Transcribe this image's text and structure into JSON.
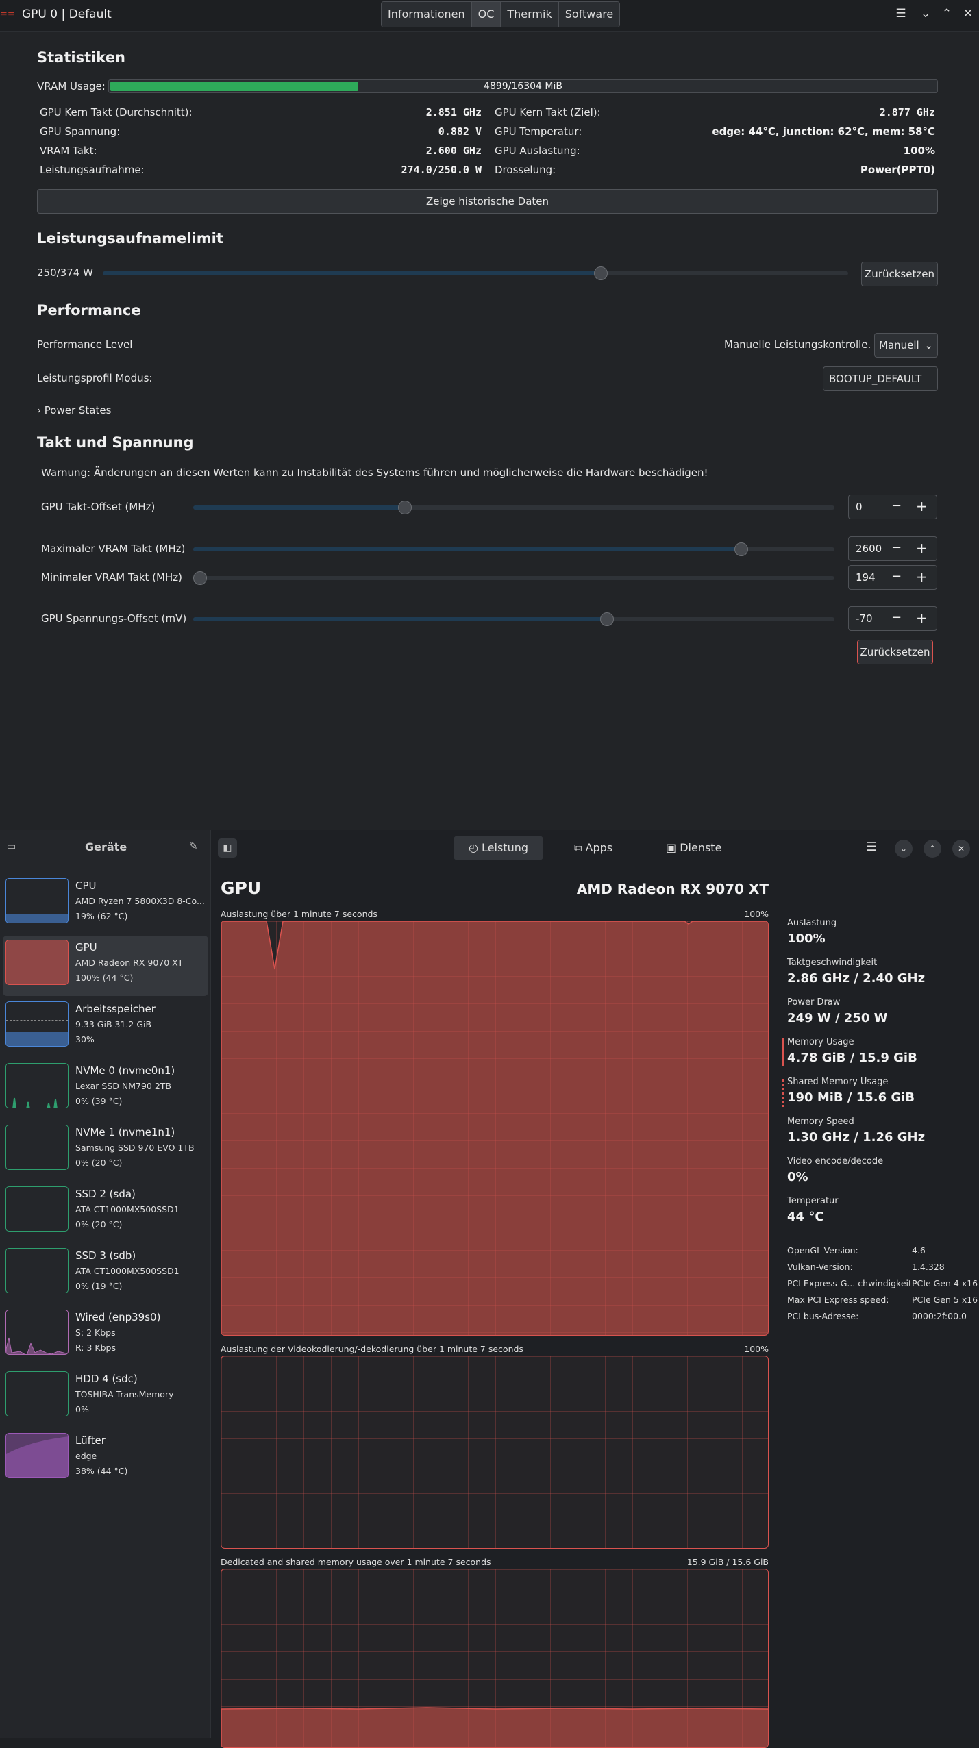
{
  "window": {
    "title": "GPU 0 | Default",
    "tabs": [
      "Informationen",
      "OC",
      "Thermik",
      "Software"
    ],
    "active_tab": "OC"
  },
  "stats": {
    "heading": "Statistiken",
    "vram_label": "VRAM Usage:",
    "vram_text": "4899/16304 MiB",
    "vram_used": 4899,
    "vram_total": 16304,
    "left": [
      {
        "label": "GPU Kern Takt (Durchschnitt):",
        "value": "2.851 GHz"
      },
      {
        "label": "GPU Spannung:",
        "value": "0.882 V"
      },
      {
        "label": "VRAM Takt:",
        "value": "2.600 GHz"
      },
      {
        "label": "Leistungsaufnahme:",
        "value": "274.0/250.0 W"
      }
    ],
    "right": [
      {
        "label": "GPU Kern Takt (Ziel):",
        "value": "2.877 GHz"
      },
      {
        "label": "GPU Temperatur:",
        "value": "edge: 44°C, junction: 62°C, mem: 58°C"
      },
      {
        "label": "GPU Auslastung:",
        "value": "100%"
      },
      {
        "label": "Drosselung:",
        "value": "Power(PPT0)"
      }
    ],
    "history_button": "Zeige historische Daten"
  },
  "power_limit": {
    "heading": "Leistungsaufnamelimit",
    "label": "250/374 W",
    "value": 250,
    "max": 374,
    "reset": "Zurücksetzen"
  },
  "performance": {
    "heading": "Performance",
    "level_label": "Performance Level",
    "level_hint": "Manuelle Leistungskontrolle.",
    "level_value": "Manuell",
    "profile_label": "Leistungsprofil Modus:",
    "profile_value": "BOOTUP_DEFAULT",
    "power_states": "Power States"
  },
  "clock": {
    "heading": "Takt und Spannung",
    "warning": "Warnung: Änderungen an diesen Werten kann zu Instabilität des Systems führen und möglicherweise die Hardware beschädigen!",
    "rows": [
      {
        "label": "GPU Takt-Offset (MHz)",
        "value": "0",
        "fraction": 0.33
      },
      {
        "label": "Maximaler VRAM Takt (MHz)",
        "value": "2600",
        "fraction": 0.855
      },
      {
        "label": "Minimaler VRAM Takt (MHz)",
        "value": "194",
        "fraction": 0.0
      },
      {
        "label": "GPU Spannungs-Offset (mV)",
        "value": "-70",
        "fraction": 0.645
      }
    ],
    "reset": "Zurücksetzen"
  },
  "monitor": {
    "sidebar_title": "Geräte",
    "devices": [
      {
        "name": "CPU",
        "line1": "AMD Ryzen 7 5800X3D 8-Co...",
        "line2": "19% (62 °C)",
        "color": "#4a86d8"
      },
      {
        "name": "GPU",
        "line1": "AMD Radeon RX 9070 XT",
        "line2": "100% (44 °C)",
        "color": "#d9534f"
      },
      {
        "name": "Arbeitsspeicher",
        "line1": "9.33 GiB 31.2 GiB",
        "line2": "30%",
        "color": "#4a86d8"
      },
      {
        "name": "NVMe 0 (nvme0n1)",
        "line1": "Lexar SSD NM790 2TB",
        "line2": "0% (39 °C)",
        "color": "#2e9e6e"
      },
      {
        "name": "NVMe 1 (nvme1n1)",
        "line1": "Samsung SSD 970 EVO 1TB",
        "line2": "0% (20 °C)",
        "color": "#2e9e6e"
      },
      {
        "name": "SSD 2 (sda)",
        "line1": "ATA CT1000MX500SSD1",
        "line2": "0% (20 °C)",
        "color": "#2e9e6e"
      },
      {
        "name": "SSD 3 (sdb)",
        "line1": "ATA CT1000MX500SSD1",
        "line2": "0% (19 °C)",
        "color": "#2e9e6e"
      },
      {
        "name": "Wired (enp39s0)",
        "line1": "S: 2 Kbps",
        "line2": "R: 3 Kbps",
        "color": "#b06ab3"
      },
      {
        "name": "HDD 4 (sdc)",
        "line1": "TOSHIBA TransMemory",
        "line2": "0%",
        "color": "#2e9e6e"
      },
      {
        "name": "Lüfter",
        "line1": "edge",
        "line2": "38% (44 °C)",
        "color": "#9b59b6"
      }
    ],
    "tabs": [
      "Leistung",
      "Apps",
      "Dienste"
    ],
    "title": "GPU",
    "device_name": "AMD Radeon RX 9070 XT",
    "graph1_label": "Auslastung über 1 minute 7 seconds",
    "graph1_max": "100%",
    "graph2_label": "Auslastung der Videokodierung/-dekodierung über 1 minute 7 seconds",
    "graph2_max": "100%",
    "graph3_label": "Dedicated and shared memory usage over 1 minute 7 seconds",
    "graph3_max": "15.9 GiB / 15.6 GiB",
    "stats": [
      {
        "label": "Auslastung",
        "value": "100%"
      },
      {
        "label": "Taktgeschwindigkeit",
        "value": "2.86 GHz / 2.40 GHz"
      },
      {
        "label": "Power Draw",
        "value": "249 W / 250 W"
      },
      {
        "label": "Memory Usage",
        "value": "4.78 GiB / 15.9 GiB"
      },
      {
        "label": "Shared Memory Usage",
        "value": "190 MiB / 15.6 GiB"
      },
      {
        "label": "Memory Speed",
        "value": "1.30 GHz / 1.26 GHz"
      },
      {
        "label": "Video encode/decode",
        "value": "0%"
      },
      {
        "label": "Temperatur",
        "value": "44 °C"
      }
    ],
    "info": [
      {
        "key": "OpenGL-Version:",
        "value": "4.6"
      },
      {
        "key": "Vulkan-Version:",
        "value": "1.4.328"
      },
      {
        "key": "PCI Express-G... chwindigkeit:",
        "value": "PCIe Gen 4 x16"
      },
      {
        "key": "Max PCI Express speed:",
        "value": "PCIe Gen 5 x16"
      },
      {
        "key": "PCI bus-Adresse:",
        "value": "0000:2f:00.0"
      }
    ]
  }
}
